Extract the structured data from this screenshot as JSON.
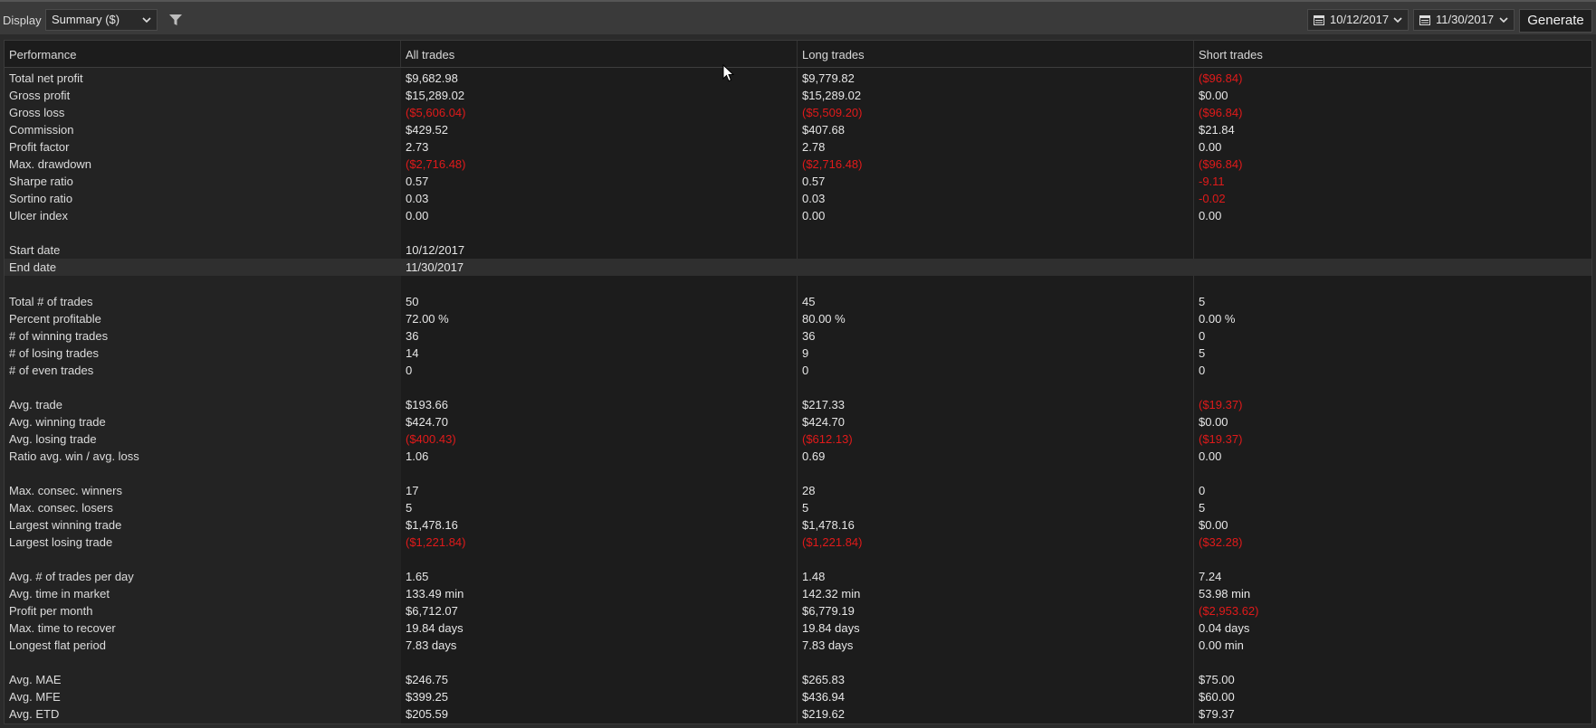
{
  "toolbar": {
    "display_label": "Display",
    "display_value": "Summary ($)",
    "start_date": "10/12/2017",
    "end_date": "11/30/2017",
    "generate_label": "Generate"
  },
  "columns": [
    "Performance",
    "All trades",
    "Long trades",
    "Short trades"
  ],
  "rows": [
    {
      "label": "Total net profit",
      "all": "$9,682.98",
      "long": "$9,779.82",
      "short": "($96.84)"
    },
    {
      "label": "Gross profit",
      "all": "$15,289.02",
      "long": "$15,289.02",
      "short": "$0.00"
    },
    {
      "label": "Gross loss",
      "all": "($5,606.04)",
      "long": "($5,509.20)",
      "short": "($96.84)"
    },
    {
      "label": "Commission",
      "all": "$429.52",
      "long": "$407.68",
      "short": "$21.84"
    },
    {
      "label": "Profit factor",
      "all": "2.73",
      "long": "2.78",
      "short": "0.00"
    },
    {
      "label": "Max. drawdown",
      "all": "($2,716.48)",
      "long": "($2,716.48)",
      "short": "($96.84)"
    },
    {
      "label": "Sharpe ratio",
      "all": "0.57",
      "long": "0.57",
      "short": "-9.11"
    },
    {
      "label": "Sortino ratio",
      "all": "0.03",
      "long": "0.03",
      "short": "-0.02"
    },
    {
      "label": "Ulcer index",
      "all": "0.00",
      "long": "0.00",
      "short": "0.00"
    },
    {
      "label": "",
      "all": "",
      "long": "",
      "short": ""
    },
    {
      "label": "Start date",
      "all": "10/12/2017",
      "long": "",
      "short": ""
    },
    {
      "label": "End date",
      "all": "11/30/2017",
      "long": "",
      "short": "",
      "selected": true
    },
    {
      "label": "",
      "all": "",
      "long": "",
      "short": ""
    },
    {
      "label": "Total # of trades",
      "all": "50",
      "long": "45",
      "short": "5"
    },
    {
      "label": "Percent profitable",
      "all": "72.00 %",
      "long": "80.00 %",
      "short": "0.00 %"
    },
    {
      "label": "# of winning trades",
      "all": "36",
      "long": "36",
      "short": "0"
    },
    {
      "label": "# of losing trades",
      "all": "14",
      "long": "9",
      "short": "5"
    },
    {
      "label": "# of even trades",
      "all": "0",
      "long": "0",
      "short": "0"
    },
    {
      "label": "",
      "all": "",
      "long": "",
      "short": ""
    },
    {
      "label": "Avg. trade",
      "all": "$193.66",
      "long": "$217.33",
      "short": "($19.37)"
    },
    {
      "label": "Avg. winning trade",
      "all": "$424.70",
      "long": "$424.70",
      "short": "$0.00"
    },
    {
      "label": "Avg. losing trade",
      "all": "($400.43)",
      "long": "($612.13)",
      "short": "($19.37)"
    },
    {
      "label": "Ratio avg. win / avg. loss",
      "all": "1.06",
      "long": "0.69",
      "short": "0.00"
    },
    {
      "label": "",
      "all": "",
      "long": "",
      "short": ""
    },
    {
      "label": "Max. consec. winners",
      "all": "17",
      "long": "28",
      "short": "0"
    },
    {
      "label": "Max. consec. losers",
      "all": "5",
      "long": "5",
      "short": "5"
    },
    {
      "label": "Largest winning trade",
      "all": "$1,478.16",
      "long": "$1,478.16",
      "short": "$0.00"
    },
    {
      "label": "Largest losing trade",
      "all": "($1,221.84)",
      "long": "($1,221.84)",
      "short": "($32.28)"
    },
    {
      "label": "",
      "all": "",
      "long": "",
      "short": ""
    },
    {
      "label": "Avg. # of trades per day",
      "all": "1.65",
      "long": "1.48",
      "short": "7.24"
    },
    {
      "label": "Avg. time in market",
      "all": "133.49 min",
      "long": "142.32 min",
      "short": "53.98 min"
    },
    {
      "label": "Profit per month",
      "all": "$6,712.07",
      "long": "$6,779.19",
      "short": "($2,953.62)"
    },
    {
      "label": "Max. time to recover",
      "all": "19.84 days",
      "long": "19.84 days",
      "short": "0.04 days"
    },
    {
      "label": "Longest flat period",
      "all": "7.83 days",
      "long": "7.83 days",
      "short": "0.00 min"
    },
    {
      "label": "",
      "all": "",
      "long": "",
      "short": ""
    },
    {
      "label": "Avg. MAE",
      "all": "$246.75",
      "long": "$265.83",
      "short": "$75.00"
    },
    {
      "label": "Avg. MFE",
      "all": "$399.25",
      "long": "$436.94",
      "short": "$60.00"
    },
    {
      "label": "Avg. ETD",
      "all": "$205.59",
      "long": "$219.62",
      "short": "$79.37"
    }
  ],
  "colors": {
    "negative": "#e01a1a",
    "background": "#1c1c1c",
    "toolbar": "#3a3a3a"
  }
}
